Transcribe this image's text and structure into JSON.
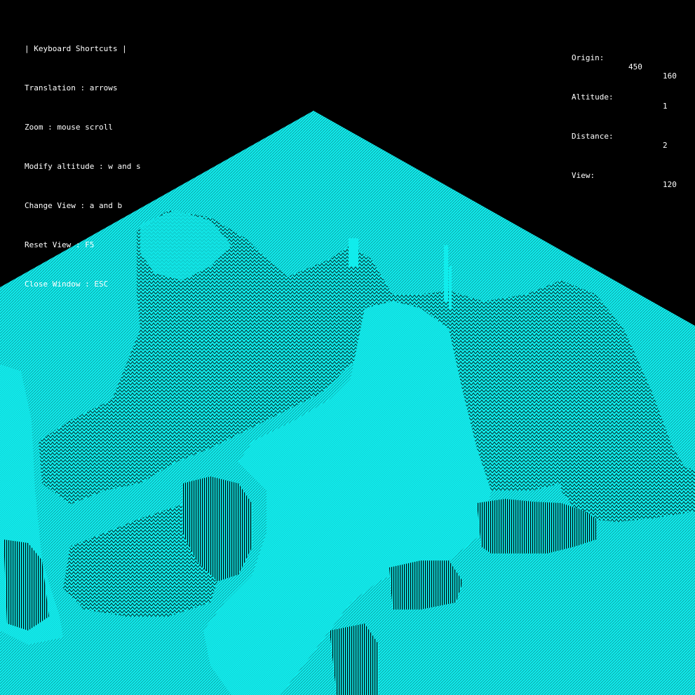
{
  "colors": {
    "background": "#000000",
    "wireframe": "#10ecec",
    "text": "#ffffff"
  },
  "shortcuts": {
    "title": "| Keyboard Shortcuts |",
    "items": [
      "Translation : arrows",
      "Zoom : mouse scroll",
      "Modify altitude : w and s",
      "Change View : a and b",
      "Reset View : F5",
      "Close Window : ESC"
    ]
  },
  "readout": {
    "origin": {
      "label": "Origin:",
      "x": "450",
      "y": "160"
    },
    "altitude": {
      "label": "Altitude:",
      "value": "1"
    },
    "distance": {
      "label": "Distance:",
      "value": "2"
    },
    "view": {
      "label": "View:",
      "value": "120"
    }
  }
}
